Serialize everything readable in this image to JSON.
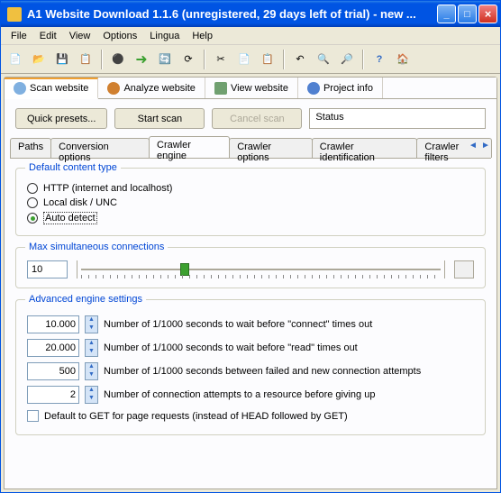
{
  "window": {
    "title": "A1 Website Download 1.1.6 (unregistered, 29 days left of trial) - new ..."
  },
  "menu": {
    "file": "File",
    "edit": "Edit",
    "view": "View",
    "options": "Options",
    "lingua": "Lingua",
    "help": "Help"
  },
  "mainTabs": {
    "scan": "Scan website",
    "analyze": "Analyze website",
    "view": "View website",
    "project": "Project info"
  },
  "actions": {
    "presets": "Quick presets...",
    "start": "Start scan",
    "cancel": "Cancel scan",
    "status": "Status"
  },
  "subTabs": {
    "paths": "Paths",
    "conv": "Conversion options",
    "engine": "Crawler engine",
    "copts": "Crawler options",
    "cid": "Crawler identification",
    "cfilt": "Crawler filters"
  },
  "groups": {
    "contentType": {
      "title": "Default content type",
      "http": "HTTP (internet and localhost)",
      "disk": "Local disk / UNC",
      "auto": "Auto detect"
    },
    "maxConn": {
      "title": "Max simultaneous connections",
      "value": "10"
    },
    "advanced": {
      "title": "Advanced engine settings",
      "v1": "10.000",
      "l1": "Number of 1/1000 seconds to wait before \"connect\" times out",
      "v2": "20.000",
      "l2": "Number of 1/1000 seconds to wait before \"read\" times out",
      "v3": "500",
      "l3": "Number of 1/1000 seconds between failed and new connection attempts",
      "v4": "2",
      "l4": "Number of connection attempts to a resource before giving up",
      "chk": "Default to GET for page requests (instead of HEAD followed by GET)"
    }
  }
}
